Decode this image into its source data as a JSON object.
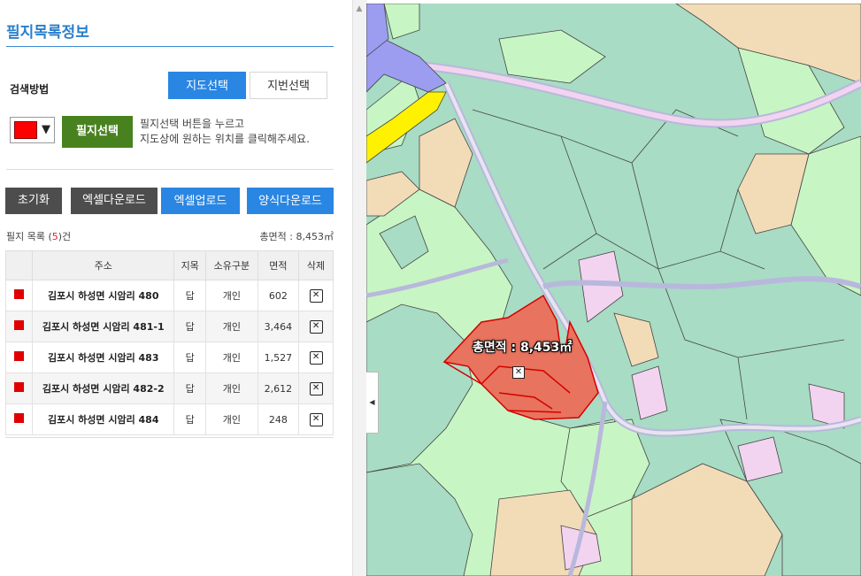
{
  "panel": {
    "title": "필지목록정보",
    "search_method_label": "검색방법",
    "tabs": [
      {
        "label": "지도선택",
        "active": true
      },
      {
        "label": "지번선택",
        "active": false
      }
    ],
    "color_selected": "#ff0000",
    "pick_button": "필지선택",
    "hint_line1": "필지선택 버튼을 누르고",
    "hint_line2": "지도상에 원하는 위치를 클릭해주세요.",
    "actions": {
      "reset": "초기화",
      "excel_download": "엑셀다운로드",
      "excel_upload": "엑셀업로드",
      "form_download": "양식다운로드"
    },
    "count_prefix": "필지 목록 (",
    "count_value": "5",
    "count_suffix": ")건",
    "total_area": "총면적 : 8,453㎡",
    "table": {
      "headers": [
        "주소",
        "지목",
        "소유구분",
        "면적",
        "삭제"
      ],
      "rows": [
        {
          "address": "김포시 하성면 시암리 480",
          "land": "답",
          "owner": "개인",
          "area": "602"
        },
        {
          "address": "김포시 하성면 시암리 481-1",
          "land": "답",
          "owner": "개인",
          "area": "3,464"
        },
        {
          "address": "김포시 하성면 시암리 483",
          "land": "답",
          "owner": "개인",
          "area": "1,527"
        },
        {
          "address": "김포시 하성면 시암리 482-2",
          "land": "답",
          "owner": "개인",
          "area": "2,612"
        },
        {
          "address": "김포시 하성면 시암리 484",
          "land": "답",
          "owner": "개인",
          "area": "248"
        }
      ]
    }
  },
  "map": {
    "selection_label": "총면적 : 8,453㎡",
    "colors": {
      "forest": "#a8dcc4",
      "paddy": "#c8f5c4",
      "field": "#f2dcb8",
      "road": "#f2d4f0",
      "highway": "#fff200",
      "water": "#9c9cf0",
      "selection": "#e8735e"
    }
  },
  "icons": {
    "delete": "close-icon",
    "dropdown": "triangle-down-icon",
    "collapse": "chevron-left-icon",
    "scroll_up": "triangle-up-icon"
  }
}
